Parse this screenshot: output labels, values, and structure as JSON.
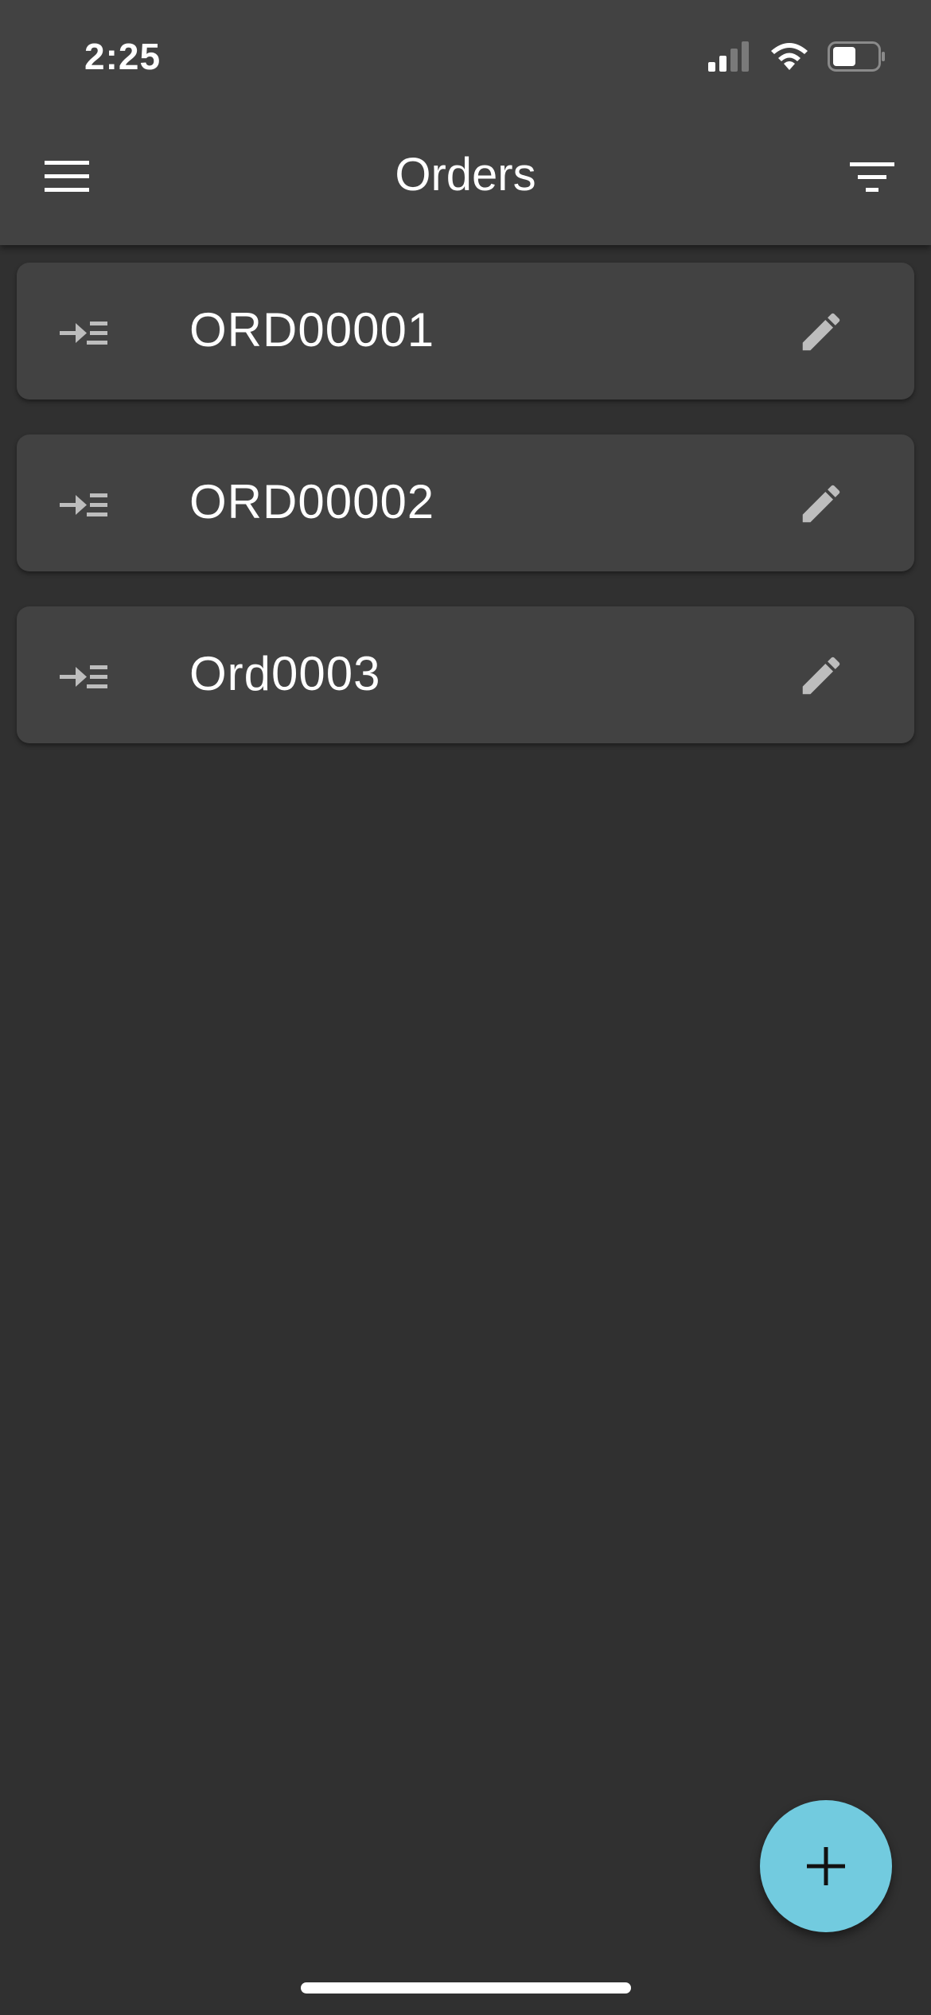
{
  "status_bar": {
    "time": "2:25",
    "icons": [
      "signal-icon",
      "wifi-icon",
      "battery-icon"
    ]
  },
  "app_bar": {
    "title": "Orders",
    "left_icon": "menu-icon",
    "right_icon": "filter-icon"
  },
  "orders": [
    {
      "id": "ORD00001",
      "lead_icon": "arrow-into-list-icon",
      "action_icon": "edit-pencil-icon"
    },
    {
      "id": "ORD00002",
      "lead_icon": "arrow-into-list-icon",
      "action_icon": "edit-pencil-icon"
    },
    {
      "id": "Ord0003",
      "lead_icon": "arrow-into-list-icon",
      "action_icon": "edit-pencil-icon"
    }
  ],
  "fab": {
    "icon": "plus-icon"
  },
  "colors": {
    "background": "#303030",
    "surface": "#424242",
    "accent": "#72cbdf",
    "icon": "#bdbdbd",
    "text": "#ffffff"
  }
}
